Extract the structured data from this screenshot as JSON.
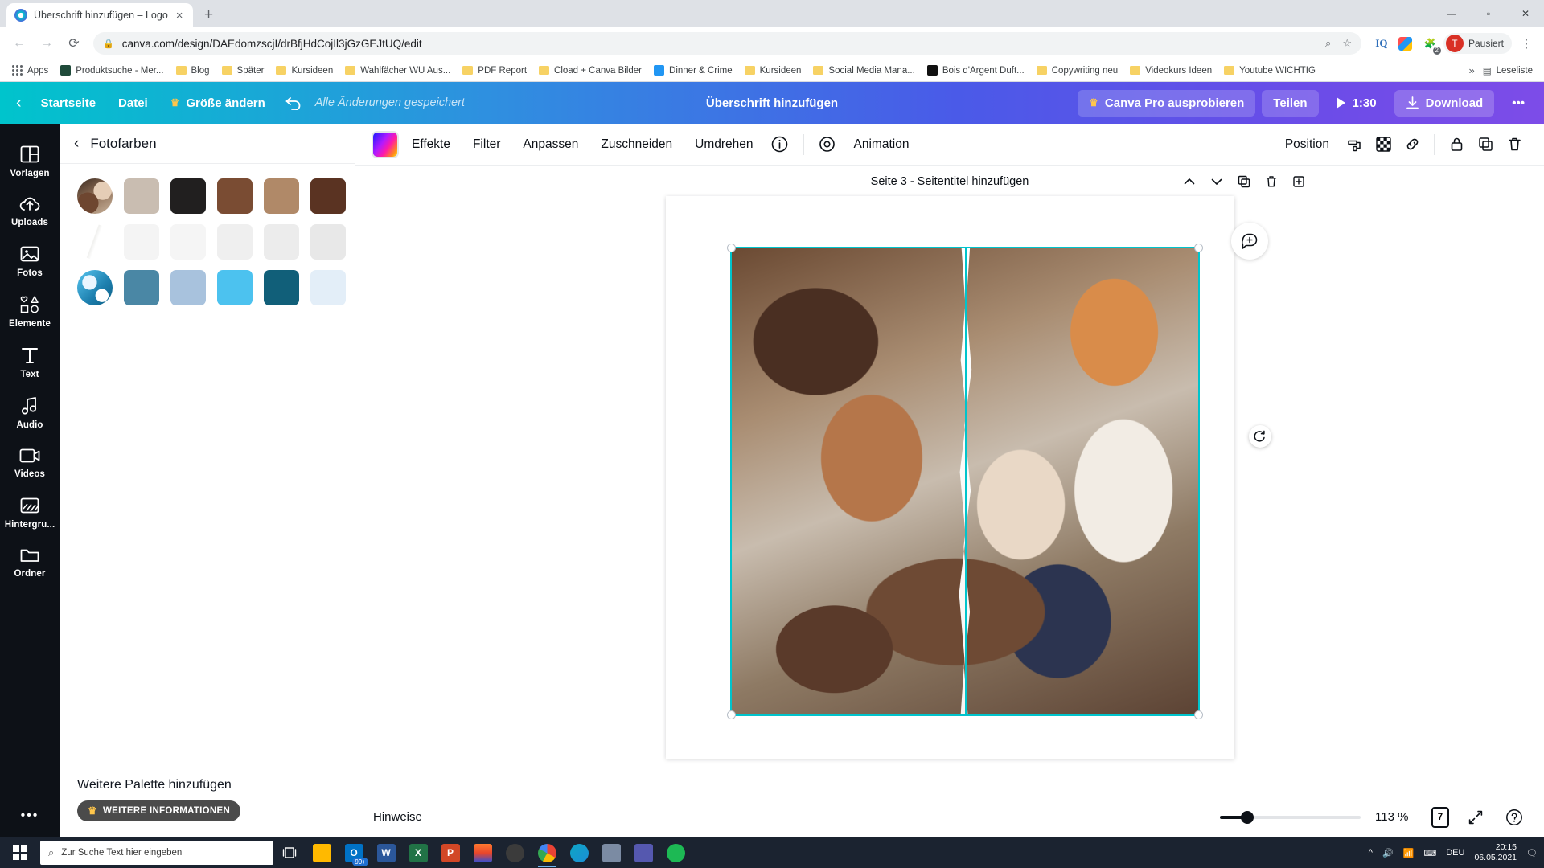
{
  "browser": {
    "tab": {
      "title": "Überschrift hinzufügen – Logo",
      "favicon": "canva-icon",
      "close": "×"
    },
    "new_tab": "+",
    "window_controls": [
      "minimize",
      "maximize",
      "close"
    ],
    "nav": {
      "back": "←",
      "forward": "→",
      "reload": "⟳"
    },
    "omnibox": {
      "lock": "lock-icon",
      "url": "canva.com/design/DAEdomzscjI/drBfjHdCojIl3jGzGEJtUQ/edit",
      "zoom_icon": "search-zoom-icon",
      "star_icon": "bookmark-star-icon"
    },
    "extensions": [
      {
        "name": "iq-extension",
        "label": "IQ"
      },
      {
        "name": "color-extension",
        "label": ""
      },
      {
        "name": "puzzle-extension",
        "label": "2"
      }
    ],
    "profile": {
      "initial": "T",
      "name": "Pausiert"
    },
    "menu": "⋮",
    "bookmarks": [
      {
        "label": "Apps",
        "icon": "apps-grid-icon"
      },
      {
        "label": "Produktsuche - Mer...",
        "icon": "site-icon",
        "color": "#1f4a3a"
      },
      {
        "label": "Blog",
        "icon": "folder-icon"
      },
      {
        "label": "Später",
        "icon": "folder-icon"
      },
      {
        "label": "Kursideen",
        "icon": "folder-icon"
      },
      {
        "label": "Wahlfächer WU Aus...",
        "icon": "folder-icon"
      },
      {
        "label": "PDF Report",
        "icon": "folder-icon"
      },
      {
        "label": "Cload + Canva Bilder",
        "icon": "folder-icon"
      },
      {
        "label": "Dinner & Crime",
        "icon": "site-icon",
        "color": "#2196f3"
      },
      {
        "label": "Kursideen",
        "icon": "folder-icon"
      },
      {
        "label": "Social Media Mana...",
        "icon": "folder-icon"
      },
      {
        "label": "Bois d'Argent Duft...",
        "icon": "site-icon",
        "color": "#111111"
      },
      {
        "label": "Copywriting neu",
        "icon": "folder-icon"
      },
      {
        "label": "Videokurs Ideen",
        "icon": "folder-icon"
      },
      {
        "label": "Youtube WICHTIG",
        "icon": "folder-icon"
      }
    ],
    "bookmarks_overflow": "»",
    "reading_list": "Leseliste"
  },
  "canva_header": {
    "back": "‹",
    "home": "Startseite",
    "file": "Datei",
    "resize": "Größe ändern",
    "resize_icon": "crown-icon",
    "undo_icon": "undo-arrow-icon",
    "saved_status": "Alle Änderungen gespeichert",
    "doc_title": "Überschrift hinzufügen",
    "pro_button": "Canva Pro ausprobieren",
    "pro_icon": "crown-icon",
    "share": "Teilen",
    "present_time": "1:30",
    "present_icon": "play-icon",
    "download": "Download",
    "download_icon": "download-icon",
    "more": "•••"
  },
  "rail": {
    "items": [
      {
        "label": "Vorlagen",
        "icon": "templates-icon"
      },
      {
        "label": "Uploads",
        "icon": "upload-cloud-icon"
      },
      {
        "label": "Fotos",
        "icon": "photo-icon"
      },
      {
        "label": "Elemente",
        "icon": "shapes-icon"
      },
      {
        "label": "Text",
        "icon": "text-icon"
      },
      {
        "label": "Audio",
        "icon": "music-note-icon"
      },
      {
        "label": "Videos",
        "icon": "video-icon"
      },
      {
        "label": "Hintergru...",
        "icon": "background-icon"
      },
      {
        "label": "Ordner",
        "icon": "folder-icon"
      }
    ],
    "more": "•••"
  },
  "panel": {
    "back_icon": "chevron-left-icon",
    "title": "Fotofarben",
    "rows": [
      {
        "thumb": "photo-thumb-people",
        "swatches": [
          "#c9bdb1",
          "#211f1f",
          "#7a4c33",
          "#b08968",
          "#5a3322"
        ]
      },
      {
        "thumb": "photo-thumb-paper",
        "swatches": [
          "#f4f4f4",
          "#f5f5f5",
          "#efefef",
          "#ececec",
          "#e8e8e8"
        ]
      },
      {
        "thumb": "photo-thumb-water",
        "swatches": [
          "#4a87a5",
          "#a8c2dd",
          "#4cc2ef",
          "#115f79",
          "#e3eef8"
        ]
      }
    ],
    "add_palette": "Weitere Palette hinzufügen",
    "more_info": "WEITERE INFORMATIONEN",
    "more_info_icon": "crown-icon"
  },
  "editor_toolbar": {
    "color_chip": "photo-color-chip",
    "items": [
      "Effekte",
      "Filter",
      "Anpassen",
      "Zuschneiden",
      "Umdrehen"
    ],
    "info_icon": "info-circle-icon",
    "animation_icon": "animation-icon",
    "animation": "Animation",
    "position": "Position",
    "right_icons": [
      "copy-style-icon",
      "transparency-icon",
      "link-icon",
      "lock-icon",
      "duplicate-icon",
      "delete-icon"
    ]
  },
  "canvas": {
    "page_label": "Seite 3 - Seitentitel hinzufügen",
    "page_tools": [
      "move-up-icon",
      "move-down-icon",
      "duplicate-page-icon",
      "delete-page-icon",
      "add-page-icon"
    ],
    "comment_icon": "comment-add-icon",
    "rotate_icon": "rotate-icon",
    "selection_color": "#00c4cc"
  },
  "status_bar": {
    "notes": "Hinweise",
    "collapse_icon": "chevron-up-icon",
    "zoom": "113 %",
    "page_number": "7",
    "fullscreen_icon": "expand-icon",
    "help_icon": "help-circle-icon"
  },
  "taskbar": {
    "start_icon": "windows-start-icon",
    "search_placeholder": "Zur Suche Text hier eingeben",
    "search_icon": "search-icon",
    "task_view_icon": "task-view-icon",
    "apps": [
      {
        "name": "file-explorer",
        "label": "",
        "color": "#ffb900"
      },
      {
        "name": "outlook",
        "label": "",
        "color": "#0072c6",
        "badge": "99+"
      },
      {
        "name": "word",
        "label": "W",
        "color": "#2b579a"
      },
      {
        "name": "excel",
        "label": "X",
        "color": "#217346"
      },
      {
        "name": "powerpoint",
        "label": "P",
        "color": "#d24726"
      },
      {
        "name": "photoshop",
        "label": "",
        "color": "#e8452b"
      },
      {
        "name": "edge-old",
        "label": "",
        "color": "#3b3b3b"
      },
      {
        "name": "chrome",
        "label": "",
        "color": "#4285f4",
        "active": true
      },
      {
        "name": "edge",
        "label": "",
        "color": "#0ea5c4"
      },
      {
        "name": "photos",
        "label": "",
        "color": "#7b8ba3"
      },
      {
        "name": "teams",
        "label": "",
        "color": "#5558af"
      },
      {
        "name": "spotify",
        "label": "",
        "color": "#1db954"
      }
    ],
    "tray": {
      "chevron": "^",
      "volume_icon": "volume-icon",
      "network_icon": "network-icon",
      "keyboard_icon": "keyboard-icon",
      "language": "DEU"
    },
    "time": "20:15",
    "date": "06.05.2021",
    "notification_icon": "notifications-icon"
  }
}
